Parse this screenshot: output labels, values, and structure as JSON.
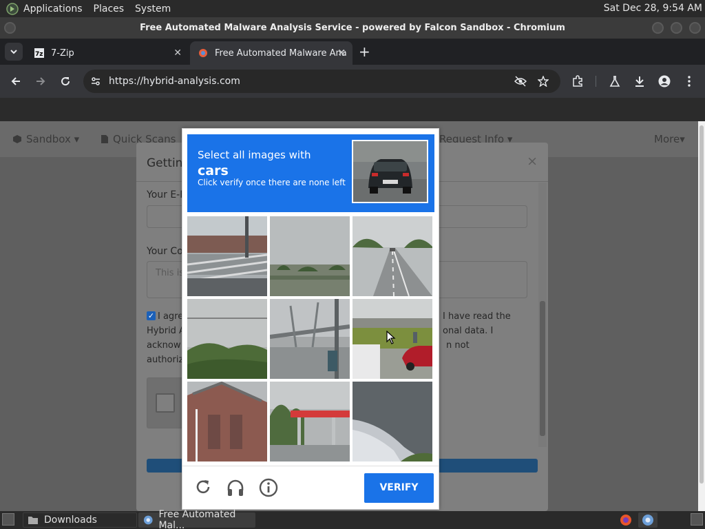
{
  "top_panel": {
    "menus": [
      "Applications",
      "Places",
      "System"
    ],
    "clock": "Sat Dec 28,  9:54 AM"
  },
  "window": {
    "title": "Free Automated Malware Analysis Service - powered by Falcon Sandbox - Chromium"
  },
  "tabs": [
    {
      "title": "7-Zip",
      "icon": "7zip-icon",
      "active": false
    },
    {
      "title": "Free Automated Malware Ana",
      "icon": "falcon-sandbox-icon",
      "active": true
    }
  ],
  "toolbar": {
    "url": "https://hybrid-analysis.com"
  },
  "site_nav": {
    "items": [
      "Sandbox",
      "Quick Scans",
      "Request Info",
      "More"
    ]
  },
  "modal": {
    "title": "Gettin",
    "email_label": "Your E-M",
    "comment_label": "Your Co",
    "comment_placeholder": "This is",
    "agree_line1_left": "I agre",
    "agree_line1_right": "I have read the",
    "agree_line2_link": "Hybrid A",
    "agree_line2_right": "onal data. I",
    "agree_line3_left": "acknow",
    "agree_line3_right": "n not",
    "agree_line4_left": "authoriz"
  },
  "captcha": {
    "instruction": "Select all images with",
    "target": "cars",
    "sub_instruction": "Click verify once there are none left",
    "verify_label": "VERIFY",
    "tiles": [
      "bridge-railing",
      "field-trees",
      "highway",
      "grass-hills",
      "bridge-pole",
      "parking-cars",
      "church",
      "gas-station",
      "car-roof"
    ]
  },
  "taskbar": {
    "items": [
      {
        "label": "Downloads",
        "icon": "folder-icon",
        "active": false
      },
      {
        "label": "Free Automated Mal...",
        "icon": "chromium-icon",
        "active": true
      }
    ]
  },
  "colors": {
    "captcha_blue": "#1a73e8",
    "chrome_dark": "#35363a",
    "tabbar": "#202124"
  }
}
